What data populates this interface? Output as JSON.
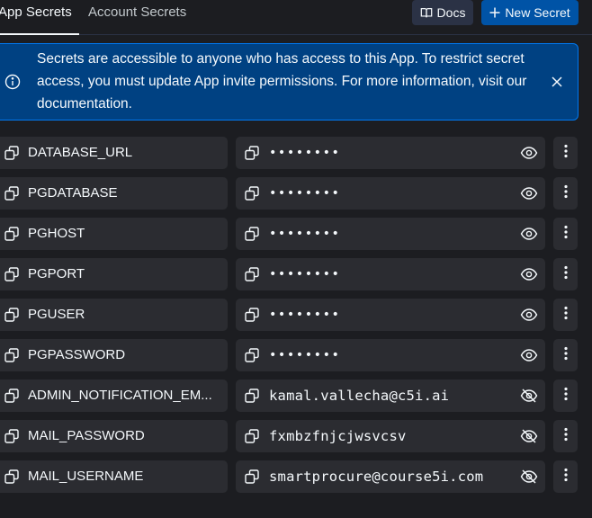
{
  "tabs": {
    "app_secrets": "App Secrets",
    "account_secrets": "Account Secrets"
  },
  "toolbar": {
    "docs_label": "Docs",
    "new_secret_label": "New Secret"
  },
  "banner": {
    "text": "Secrets are accessible to anyone who has access to this App. To restrict secret access, you must update App invite permissions. For more information, visit our documentation."
  },
  "secrets": [
    {
      "key": "DATABASE_URL",
      "value": "••••••••",
      "masked": true
    },
    {
      "key": "PGDATABASE",
      "value": "••••••••",
      "masked": true
    },
    {
      "key": "PGHOST",
      "value": "••••••••",
      "masked": true
    },
    {
      "key": "PGPORT",
      "value": "••••••••",
      "masked": true
    },
    {
      "key": "PGUSER",
      "value": "••••••••",
      "masked": true
    },
    {
      "key": "PGPASSWORD",
      "value": "••••••••",
      "masked": true
    },
    {
      "key": "ADMIN_NOTIFICATION_EM...",
      "value": "kamal.vallecha@c5i.ai",
      "masked": false
    },
    {
      "key": "MAIL_PASSWORD",
      "value": "fxmbzfnjcjwsvcsv",
      "masked": false
    },
    {
      "key": "MAIL_USERNAME",
      "value": "smartprocure@course5i.com",
      "masked": false
    }
  ],
  "colors": {
    "background": "#1c1d21",
    "surface": "#2b2c31",
    "accent": "#0053a6",
    "banner_bg": "#004182",
    "banner_border": "#0079f2",
    "text": "#f5f9fc"
  }
}
